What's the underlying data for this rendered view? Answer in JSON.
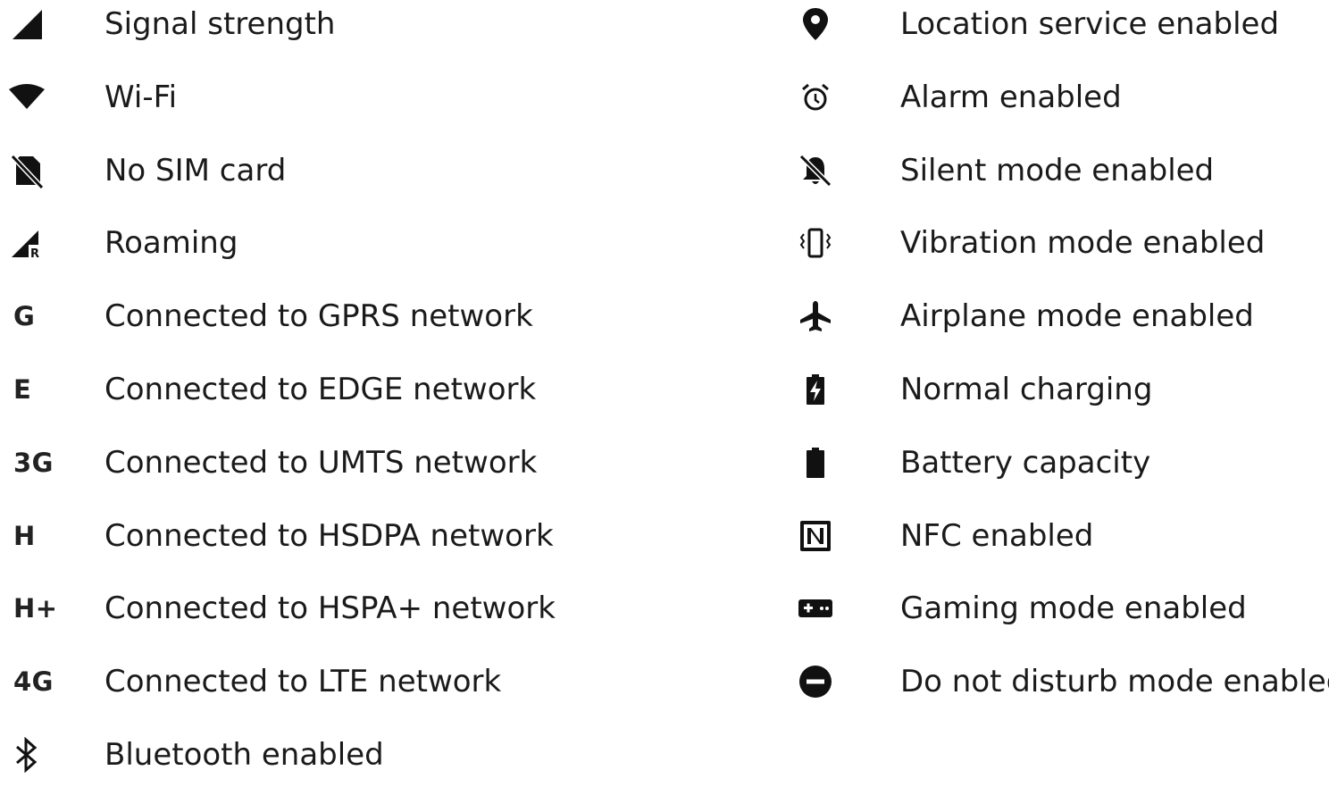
{
  "left_items": [
    {
      "icon": "signal-strength-icon",
      "label": "Signal strength"
    },
    {
      "icon": "wifi-icon",
      "label": "Wi-Fi"
    },
    {
      "icon": "no-sim-icon",
      "label": "No SIM card"
    },
    {
      "icon": "roaming-icon",
      "label": "Roaming",
      "badge": "R"
    },
    {
      "icon": "gprs-text-icon",
      "glyph": "G",
      "label": "Connected to GPRS network"
    },
    {
      "icon": "edge-text-icon",
      "glyph": "E",
      "label": "Connected to EDGE network"
    },
    {
      "icon": "umts-text-icon",
      "glyph": "3G",
      "label": "Connected to UMTS network"
    },
    {
      "icon": "hsdpa-text-icon",
      "glyph": "H",
      "label": "Connected to HSDPA network"
    },
    {
      "icon": "hspa-plus-text-icon",
      "glyph": "H+",
      "label": "Connected to HSPA+ network"
    },
    {
      "icon": "lte-text-icon",
      "glyph": "4G",
      "label": "Connected to LTE network"
    },
    {
      "icon": "bluetooth-icon",
      "label": "Bluetooth enabled"
    }
  ],
  "right_items": [
    {
      "icon": "location-pin-icon",
      "label": "Location service enabled"
    },
    {
      "icon": "alarm-clock-icon",
      "label": "Alarm enabled"
    },
    {
      "icon": "bell-off-icon",
      "label": "Silent mode enabled"
    },
    {
      "icon": "vibration-icon",
      "label": "Vibration mode enabled"
    },
    {
      "icon": "airplane-icon",
      "label": "Airplane mode enabled"
    },
    {
      "icon": "battery-charging-icon",
      "label": "Normal charging"
    },
    {
      "icon": "battery-full-icon",
      "label": "Battery capacity"
    },
    {
      "icon": "nfc-icon",
      "label": "NFC enabled"
    },
    {
      "icon": "gamepad-icon",
      "label": "Gaming mode enabled"
    },
    {
      "icon": "do-not-disturb-icon",
      "label": "Do not disturb mode enabled"
    }
  ],
  "colors": {
    "icon": "#111111",
    "text": "#1a1a1a",
    "background": "#ffffff"
  }
}
